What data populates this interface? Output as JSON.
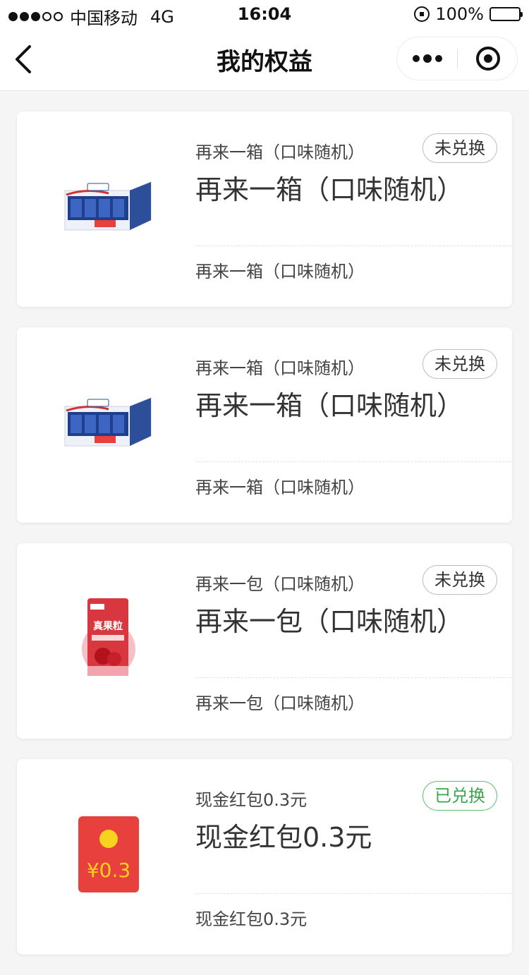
{
  "status_bar": {
    "carrier": "中国移动",
    "network": "4G",
    "time": "16:04",
    "battery": "100%"
  },
  "nav": {
    "title": "我的权益"
  },
  "cards": [
    {
      "subtitle": "再来一箱（口味随机）",
      "title": "再来一箱（口味随机）",
      "badge": "未兑换",
      "note": "再来一箱（口味随机）",
      "image": "milk-box-icon"
    },
    {
      "subtitle": "再来一箱（口味随机）",
      "title": "再来一箱（口味随机）",
      "badge": "未兑换",
      "note": "再来一箱（口味随机）",
      "image": "milk-box-icon"
    },
    {
      "subtitle": "再来一包（口味随机）",
      "title": "再来一包（口味随机）",
      "badge": "未兑换",
      "note": "再来一包（口味随机）",
      "image": "drink-pack-icon",
      "brand": "真果粒"
    },
    {
      "subtitle": "现金红包0.3元",
      "title": "现金红包0.3元",
      "badge": "已兑换",
      "note": "现金红包0.3元",
      "image": "red-envelope-icon",
      "amount": "¥0.3"
    }
  ],
  "colors": {
    "redeemed": "#3aa64a",
    "unredeemed_border": "#bdbdbd",
    "envelope": "#e8403d"
  }
}
